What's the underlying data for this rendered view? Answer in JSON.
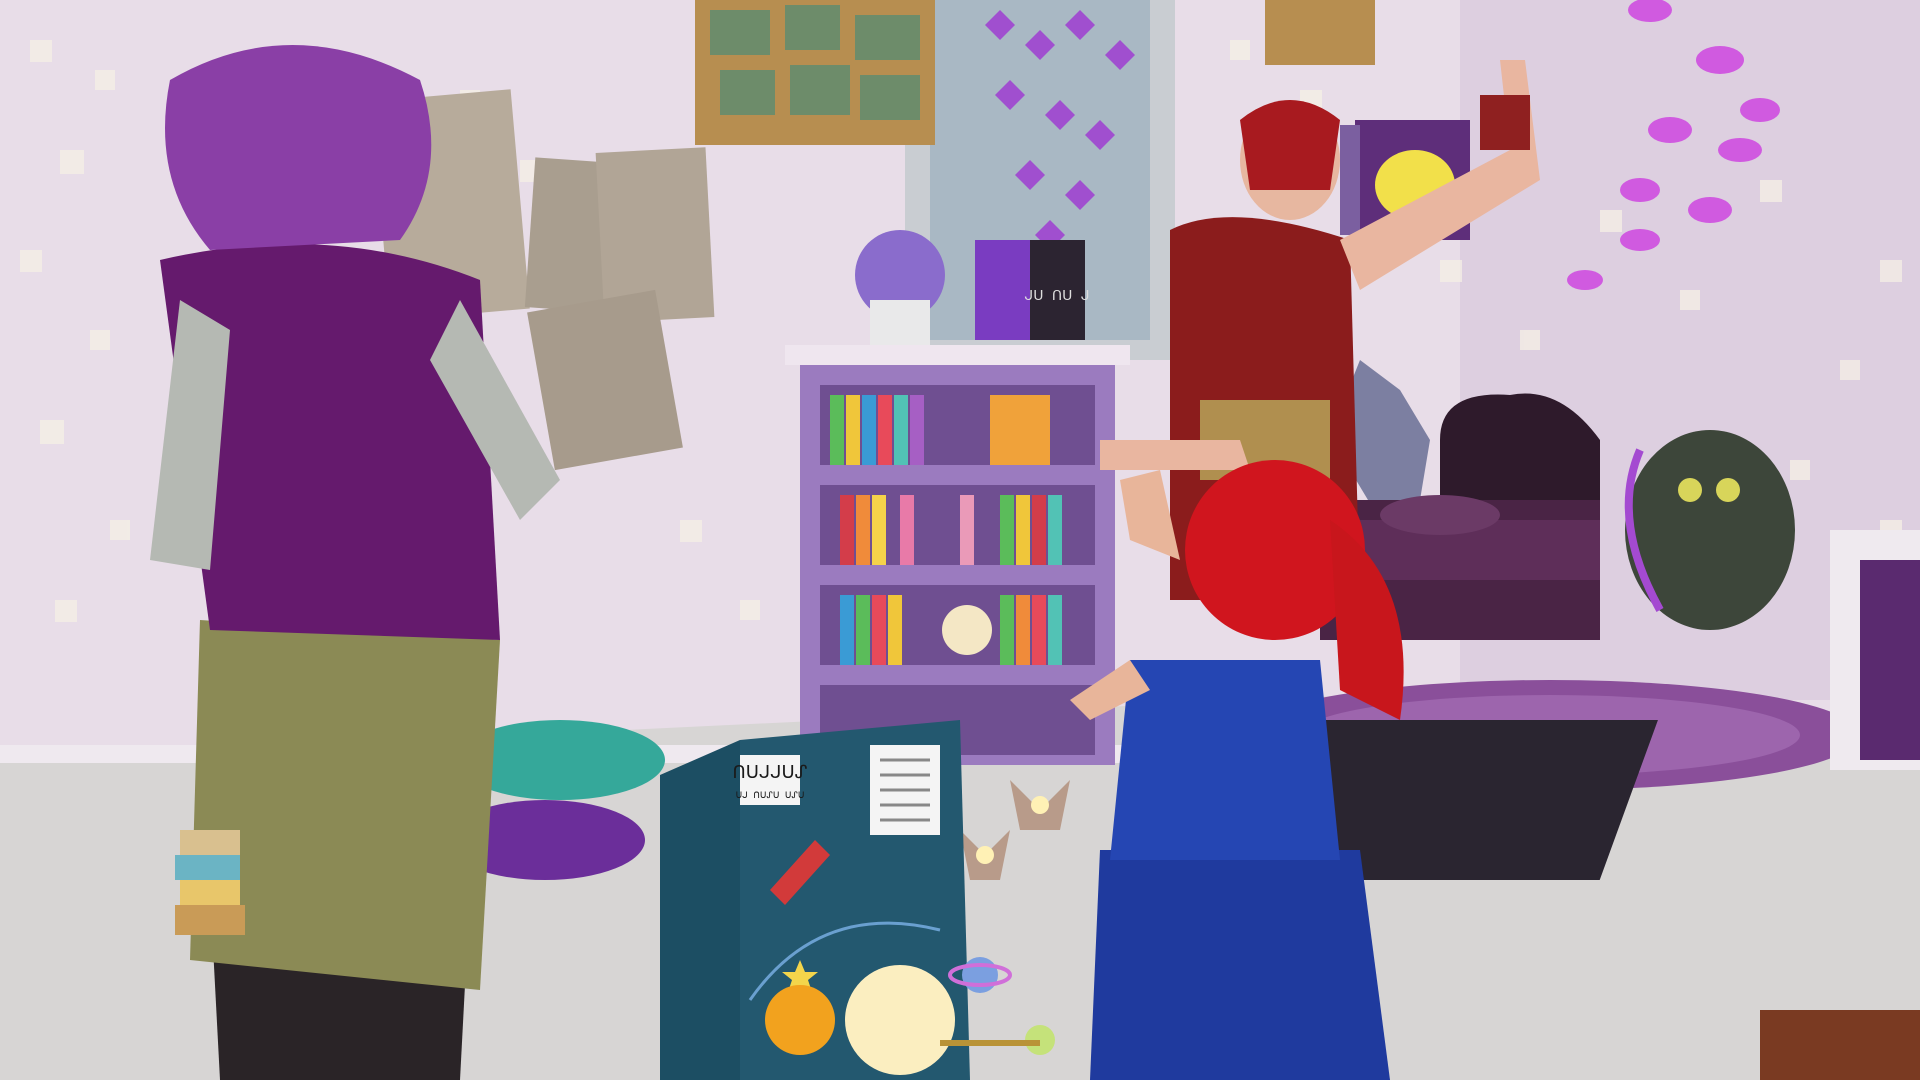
{
  "scene": {
    "colors": {
      "wall": "#e6dbe6",
      "wall_shadow": "#cbbdcc",
      "floor": "#d8d6d6",
      "rug": "#8a4f9a",
      "bookcase": "#9b7bbf",
      "bed": "#3a1e35",
      "purple_shirt": "#6a1b72",
      "apron": "#8c8a55",
      "blue_dress": "#1f3a9e",
      "red_top": "#8b1c1c",
      "red_hair": "#c8161c",
      "purple_hair": "#8a3fa6"
    },
    "poster_title": "ᑎᑌᒍᒍᑌᔑ",
    "poster_subtitle": "ᑌᒍ ᑎᑌᔑᑌ ᑌᔑᑌ",
    "book_spine": "ᒍᑌ ᑎᑌ ᒍ"
  }
}
